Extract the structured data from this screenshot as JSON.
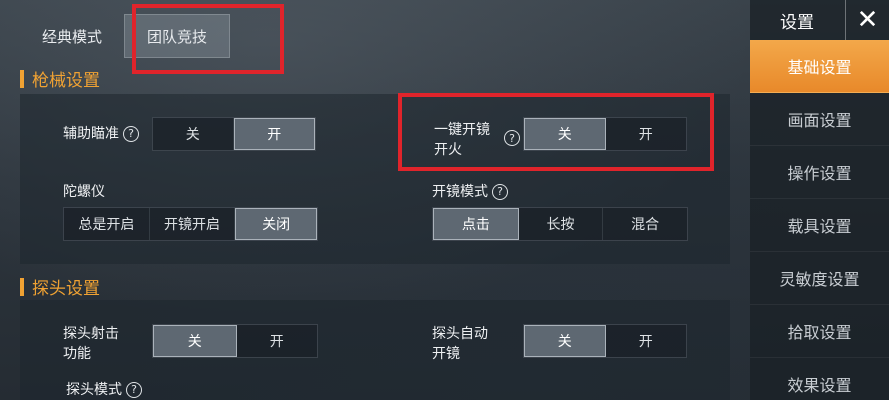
{
  "tabs": [
    {
      "label": "经典模式"
    },
    {
      "label": "团队竞技"
    }
  ],
  "sections": {
    "gun": {
      "title": "枪械设置"
    },
    "peek": {
      "title": "探头设置"
    }
  },
  "settings": {
    "aim_assist": {
      "label": "辅助瞄准",
      "help": "?",
      "options": [
        "关",
        "开"
      ],
      "selected": "开"
    },
    "one_tap_scope_fire": {
      "label_line1": "一键开镜",
      "label_line2": "开火",
      "help": "?",
      "options": [
        "关",
        "开"
      ],
      "selected": "关"
    },
    "gyroscope": {
      "label": "陀螺仪",
      "options": [
        "总是开启",
        "开镜开启",
        "关闭"
      ],
      "selected": "关闭"
    },
    "scope_mode": {
      "label": "开镜模式",
      "help": "?",
      "options": [
        "点击",
        "长按",
        "混合"
      ],
      "selected": "点击"
    },
    "peek_fire": {
      "label_line1": "探头射击",
      "label_line2": "功能",
      "options": [
        "关",
        "开"
      ],
      "selected": "关"
    },
    "peek_auto_scope": {
      "label_line1": "探头自动",
      "label_line2": "开镜",
      "options": [
        "关",
        "开"
      ],
      "selected": "关"
    },
    "peek_mode": {
      "label": "探头模式",
      "help": "?"
    }
  },
  "sidebar": {
    "title": "设置",
    "close_icon": "close-icon",
    "items": [
      {
        "label": "基础设置",
        "active": true
      },
      {
        "label": "画面设置"
      },
      {
        "label": "操作设置"
      },
      {
        "label": "载具设置"
      },
      {
        "label": "灵敏度设置"
      },
      {
        "label": "拾取设置"
      },
      {
        "label": "效果设置"
      }
    ]
  },
  "colors": {
    "accent": "#f0a233",
    "highlight": "#e0242b",
    "active_tab_sidebar": "#eb922f"
  }
}
